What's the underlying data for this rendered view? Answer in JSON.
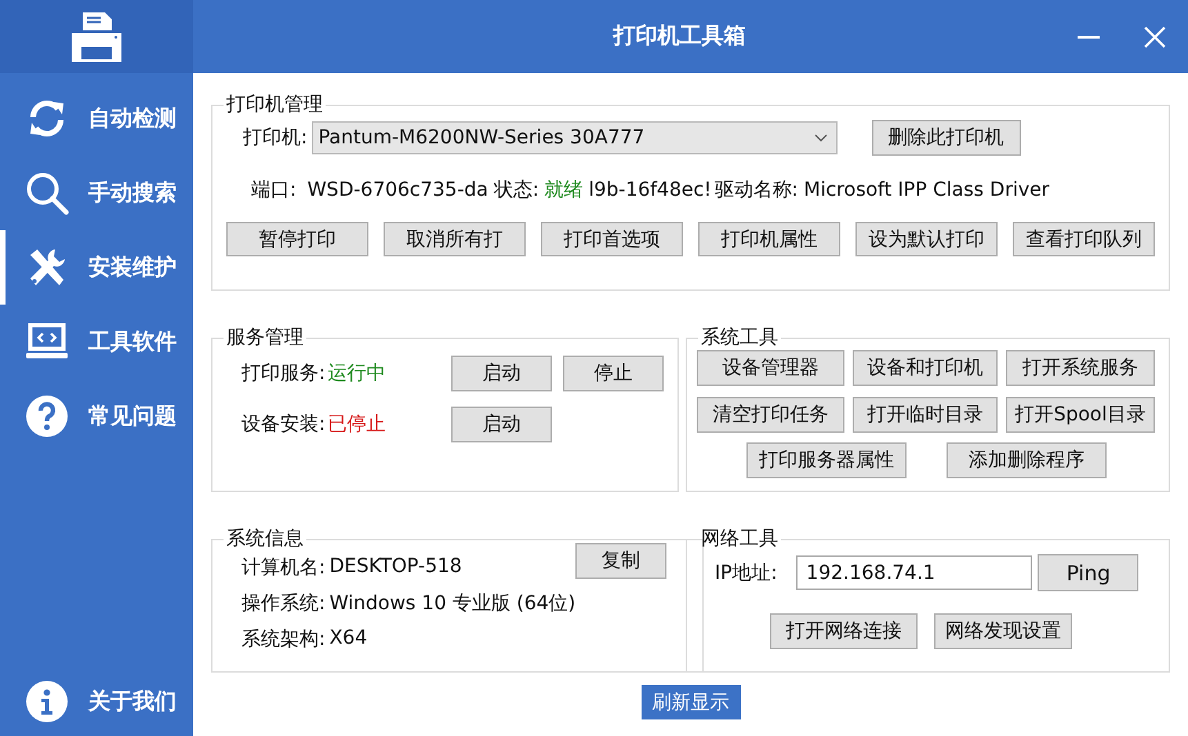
{
  "window": {
    "title": "打印机工具箱"
  },
  "sidebar": {
    "items": [
      {
        "label": "自动检测",
        "selected": false
      },
      {
        "label": "手动搜索",
        "selected": false
      },
      {
        "label": "安装维护",
        "selected": true
      },
      {
        "label": "工具软件",
        "selected": false
      },
      {
        "label": "常见问题",
        "selected": false
      }
    ],
    "footer_item": {
      "label": "关于我们"
    }
  },
  "printer_management": {
    "title": "打印机管理",
    "printer_label": "打印机:",
    "printer_value": "Pantum-M6200NW-Series 30A777",
    "delete_button": "删除此打印机",
    "port_label": "端口:",
    "port_value": "WSD-6706c735-da",
    "status_label": "状态:",
    "status_value": "就绪",
    "port_tail": "l9b-16f48ec!",
    "driver_label": "驱动名称:",
    "driver_value": "Microsoft IPP Class Driver",
    "buttons": [
      "暂停打印",
      "取消所有打",
      "打印首选项",
      "打印机属性",
      "设为默认打印",
      "查看打印队列"
    ]
  },
  "service_management": {
    "title": "服务管理",
    "services": [
      {
        "label": "打印服务:",
        "status": "运行中",
        "running": true,
        "buttons": [
          "启动",
          "停止"
        ]
      },
      {
        "label": "设备安装:",
        "status": "已停止",
        "running": false,
        "buttons": [
          "启动"
        ]
      }
    ]
  },
  "system_tools": {
    "title": "系统工具",
    "buttons": [
      "设备管理器",
      "设备和打印机",
      "打开系统服务",
      "清空打印任务",
      "打开临时目录",
      "打开Spool目录",
      "打印服务器属性",
      "添加删除程序"
    ]
  },
  "system_info": {
    "title": "系统信息",
    "rows": [
      {
        "label": "计算机名:",
        "value": "DESKTOP-518"
      },
      {
        "label": "操作系统:",
        "value": "Windows 10 专业版 (64位)"
      },
      {
        "label": "系统架构:",
        "value": "X64"
      }
    ],
    "copy_button": "复制"
  },
  "network_tools": {
    "title": "网络工具",
    "ip_label": "IP地址:",
    "ip_value": "192.168.74.1",
    "ping_button": "Ping",
    "buttons": [
      "打开网络连接",
      "网络发现设置"
    ]
  },
  "refresh_button": "刷新显示"
}
